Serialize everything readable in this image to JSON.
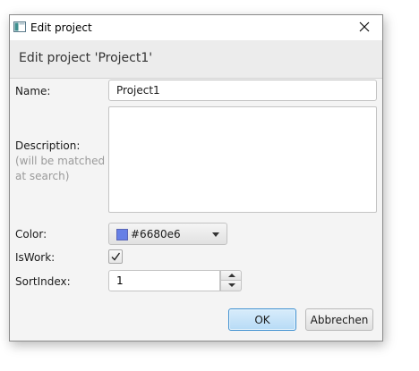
{
  "window": {
    "title": "Edit project"
  },
  "header": {
    "text": "Edit project 'Project1'"
  },
  "form": {
    "name_label": "Name:",
    "name_value": "Project1",
    "description_label": "Description:",
    "description_hint_line1": "(will be matched",
    "description_hint_line2": "at search)",
    "description_value": "",
    "color_label": "Color:",
    "color_value": "#6680e6",
    "iswork_label": "IsWork:",
    "iswork_checked": true,
    "sortindex_label": "SortIndex:",
    "sortindex_value": "1"
  },
  "buttons": {
    "ok_label": "OK",
    "cancel_label": "Abbrechen"
  },
  "icons": {
    "app": "window-app-icon",
    "close": "close-icon",
    "dropdown": "chevron-down-icon",
    "check": "checkmark-icon",
    "spin_up": "spin-up-icon",
    "spin_down": "spin-down-icon"
  },
  "colors": {
    "swatch": "#6680e6",
    "ok_border": "#3d8fd0"
  }
}
